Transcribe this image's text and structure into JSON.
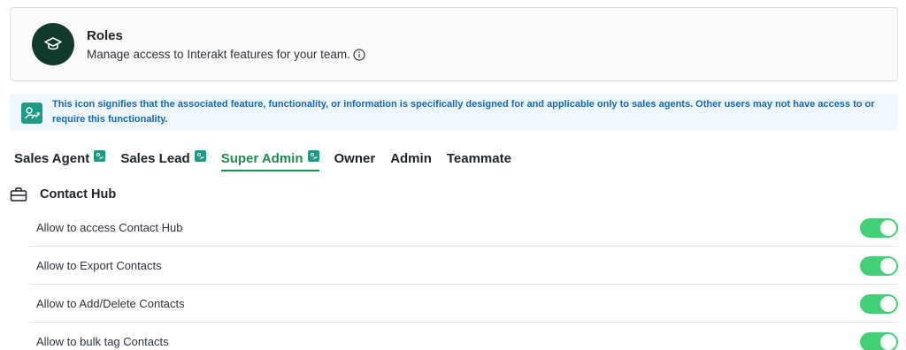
{
  "roles_card": {
    "title": "Roles",
    "subtitle": "Manage access to Interakt features for your team.",
    "avatar_icon": "graduation-cap-icon",
    "info_icon": "info-icon"
  },
  "notice": {
    "icon": "sales-agent-icon",
    "text": "This icon signifies that the associated feature, functionality, or information is specifically designed for and applicable only to sales agents. Other users may not have access to or require this functionality."
  },
  "tabs": [
    {
      "label": "Sales Agent",
      "sales_badge": true,
      "active": false
    },
    {
      "label": "Sales Lead",
      "sales_badge": true,
      "active": false
    },
    {
      "label": "Super Admin",
      "sales_badge": true,
      "active": true
    },
    {
      "label": "Owner",
      "sales_badge": false,
      "active": false
    },
    {
      "label": "Admin",
      "sales_badge": false,
      "active": false
    },
    {
      "label": "Teammate",
      "sales_badge": false,
      "active": false
    }
  ],
  "section": {
    "title": "Contact Hub",
    "icon": "briefcase-icon"
  },
  "permissions": [
    {
      "label": "Allow to access Contact Hub",
      "enabled": true
    },
    {
      "label": "Allow to Export Contacts",
      "enabled": true
    },
    {
      "label": "Allow to Add/Delete Contacts",
      "enabled": true
    },
    {
      "label": "Allow to bulk tag Contacts",
      "enabled": true
    }
  ],
  "colors": {
    "accent_green": "#1f8a52",
    "toggle_on": "#42cf76",
    "notice_bg": "#eef7fd",
    "notice_text": "#1668b0",
    "avatar_bg": "#113a2b",
    "sales_badge": "#1d9a83"
  }
}
